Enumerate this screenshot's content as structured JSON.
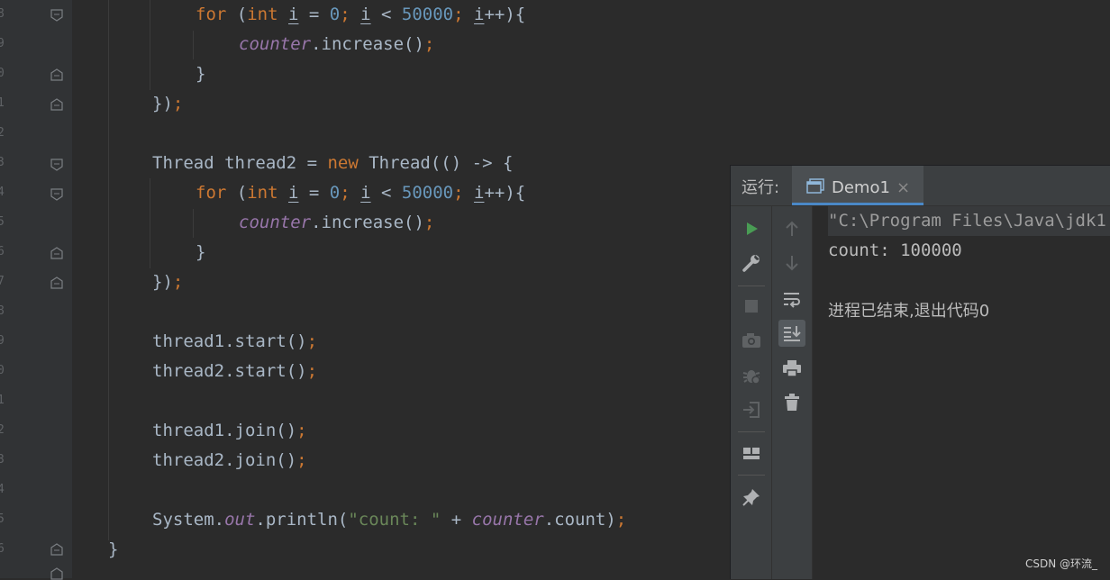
{
  "gutter": {
    "line_numbers": [
      "8",
      "9",
      "0",
      "1",
      "2",
      "3",
      "4",
      "5",
      "6",
      "7",
      "8",
      "9",
      "0",
      "1",
      "2",
      "3",
      "4",
      "5",
      "6"
    ]
  },
  "code": {
    "l1": {
      "kw_for": "for",
      "open": " (",
      "kw_int": "int",
      "sp": " ",
      "var_i": "i",
      "eq": " = ",
      "zero": "0",
      "semi1": ";",
      "sp2": " ",
      "var_i2": "i",
      "lt": " < ",
      "limit": "50000",
      "semi2": ";",
      "sp3": " ",
      "var_i3": "i",
      "inc": "++){"
    },
    "l2": {
      "field": "counter",
      "rest": ".increase()",
      "semi": ";"
    },
    "l3": {
      "text": "}"
    },
    "l4": {
      "text": "})",
      "semi": ";"
    },
    "l6": {
      "a": "Thread thread2 = ",
      "kw_new": "new",
      "b": " Thread(() -> {"
    },
    "l7": {
      "kw_for": "for",
      "open": " (",
      "kw_int": "int",
      "sp": " ",
      "var_i": "i",
      "eq": " = ",
      "zero": "0",
      "semi1": ";",
      "sp2": " ",
      "var_i2": "i",
      "lt": " < ",
      "limit": "50000",
      "semi2": ";",
      "sp3": " ",
      "var_i3": "i",
      "inc": "++){"
    },
    "l8": {
      "field": "counter",
      "rest": ".increase()",
      "semi": ";"
    },
    "l9": {
      "text": "}"
    },
    "l10": {
      "text": "})",
      "semi": ";"
    },
    "l12": {
      "text": "thread1.start()",
      "semi": ";"
    },
    "l13": {
      "text": "thread2.start()",
      "semi": ";"
    },
    "l15": {
      "text": "thread1.join()",
      "semi": ";"
    },
    "l16": {
      "text": "thread2.join()",
      "semi": ";"
    },
    "l18": {
      "a": "System.",
      "out": "out",
      "b": ".println(",
      "str": "\"count: \"",
      "c": " + ",
      "field": "counter",
      "d": ".count)",
      "semi": ";"
    },
    "l19": {
      "text": "}"
    }
  },
  "run_panel": {
    "title": "运行:",
    "tab_label": "Demo1",
    "tab_close": "×",
    "icons": [
      "run-icon",
      "wrench-icon",
      "stop-icon",
      "camera-icon",
      "debug-icon",
      "exit-icon",
      "layout-icon",
      "pin-icon",
      "arrow-up-icon",
      "arrow-down-icon",
      "soft-wrap-icon",
      "scroll-to-end-icon",
      "print-icon",
      "trash-icon"
    ],
    "console": {
      "cmd_line": "\"C:\\Program Files\\Java\\jdk1",
      "output_line": "count: 100000",
      "exit_line": "进程已结束,退出代码0"
    },
    "colors": {
      "run_green": "#499c54",
      "tab_underline": "#4a88c7"
    }
  },
  "watermark": "CSDN @环流_"
}
